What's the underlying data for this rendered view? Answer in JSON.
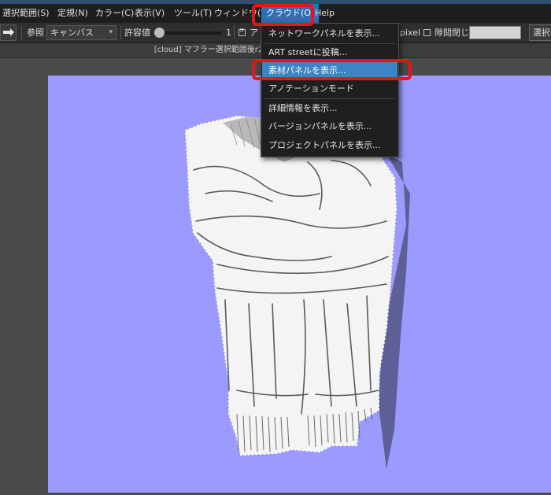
{
  "menubar": {
    "items": [
      {
        "label": "選択範囲(S)"
      },
      {
        "label": "定規(N)"
      },
      {
        "label": "カラー(C)"
      },
      {
        "label": "表示(V)"
      },
      {
        "label": "ツール(T)"
      },
      {
        "label": "ウィンドウ(W"
      },
      {
        "label": "クラウド(O)"
      },
      {
        "label": "Help"
      }
    ]
  },
  "toolbar": {
    "ref_label": "参照",
    "ref_value": "キャンバス",
    "tolerance_label": "許容値",
    "tolerance_value": "1",
    "antialias_label": "ア",
    "pixel_label": "pixel",
    "gap_close_label": "隙間閉じ",
    "select_button_label": "選択"
  },
  "document": {
    "title": "[cloud] マフラー選択範囲後r2"
  },
  "cloud_menu": {
    "items": [
      {
        "label": "ネットワークパネルを表示..."
      },
      {
        "label": "ART streetに投稿..."
      },
      {
        "label": "素材パネルを表示..."
      },
      {
        "label": "アノテーションモード"
      },
      {
        "label": "詳細情報を表示..."
      },
      {
        "label": "バージョンパネルを表示..."
      },
      {
        "label": "プロジェクトパネルを表示..."
      }
    ]
  },
  "colors": {
    "canvas_bg": "#9b9bff",
    "highlight": "#e8141c",
    "menu_active": "#2f6fb5"
  }
}
